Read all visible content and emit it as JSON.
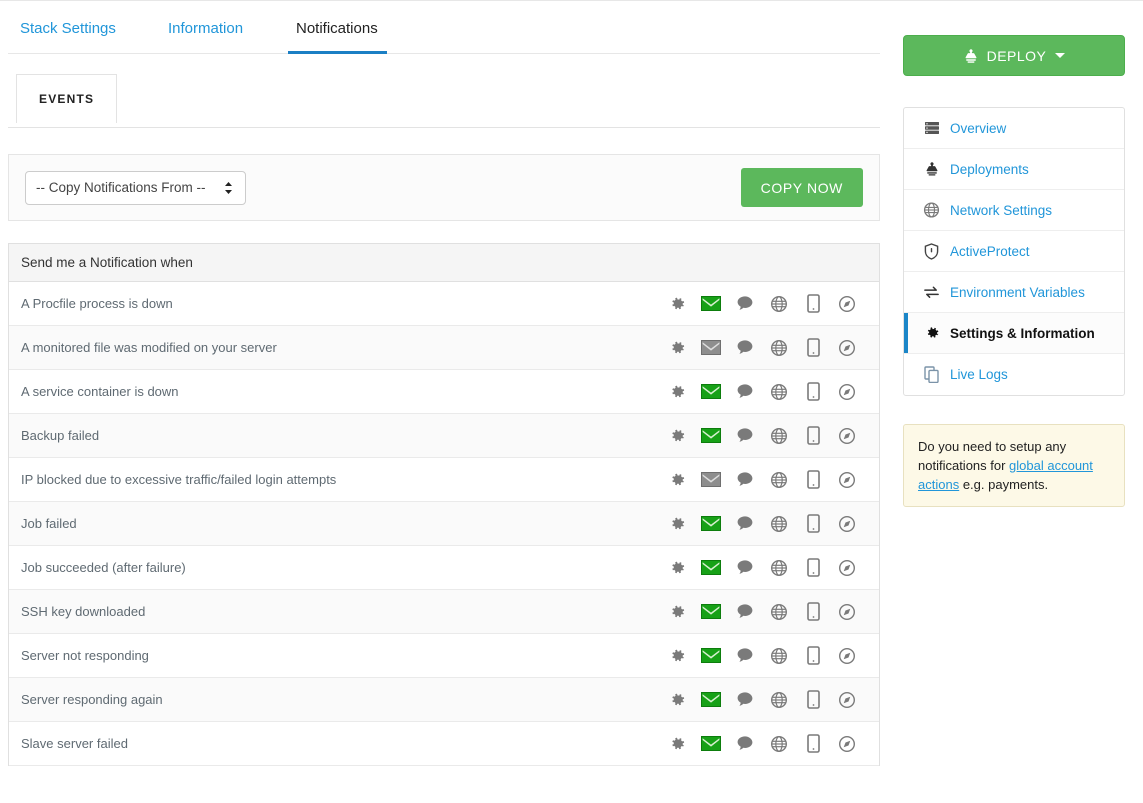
{
  "nav_tabs": [
    {
      "label": "Stack Settings",
      "active": false
    },
    {
      "label": "Information",
      "active": false
    },
    {
      "label": "Notifications",
      "active": true
    }
  ],
  "subtab": {
    "label": "EVENTS"
  },
  "copy_panel": {
    "select_value": "-- Copy Notifications From --",
    "copy_button": "COPY NOW"
  },
  "notifications": {
    "header": "Send me a Notification when",
    "icon_names": [
      "gear-icon",
      "envelope-icon",
      "speech-bubble-icon",
      "globe-icon",
      "mobile-icon",
      "compass-icon"
    ],
    "rows": [
      {
        "label": "A Procfile process is down",
        "email_active": true
      },
      {
        "label": "A monitored file was modified on your server",
        "email_active": false
      },
      {
        "label": "A service container is down",
        "email_active": true
      },
      {
        "label": "Backup failed",
        "email_active": true
      },
      {
        "label": "IP blocked due to excessive traffic/failed login attempts",
        "email_active": false
      },
      {
        "label": "Job failed",
        "email_active": true
      },
      {
        "label": "Job succeeded (after failure)",
        "email_active": true
      },
      {
        "label": "SSH key downloaded",
        "email_active": true
      },
      {
        "label": "Server not responding",
        "email_active": true
      },
      {
        "label": "Server responding again",
        "email_active": true
      },
      {
        "label": "Slave server failed",
        "email_active": true
      }
    ]
  },
  "deploy_button": {
    "label": "DEPLOY",
    "icon": "rocket-icon"
  },
  "sidebar": {
    "items": [
      {
        "label": "Overview",
        "icon": "server-icon",
        "active": false
      },
      {
        "label": "Deployments",
        "icon": "rocket-icon",
        "active": false
      },
      {
        "label": "Network Settings",
        "icon": "globe-icon",
        "active": false
      },
      {
        "label": "ActiveProtect",
        "icon": "shield-icon",
        "active": false
      },
      {
        "label": "Environment Variables",
        "icon": "exchange-icon",
        "active": false
      },
      {
        "label": "Settings & Information",
        "icon": "gear-icon",
        "active": true
      },
      {
        "label": "Live Logs",
        "icon": "copy-icon",
        "active": false
      }
    ]
  },
  "notice": {
    "text_before": "Do you need to setup any notifications for ",
    "link_text": "global account actions",
    "text_after": " e.g. payments."
  },
  "colors": {
    "accent_blue": "#2196d9",
    "active_tab_underline": "#1b7fc4",
    "green": "#5cb85c",
    "envelope_active": "#1aa81a",
    "envelope_inactive": "#8b8b8b",
    "notice_bg": "#fdf9e7"
  }
}
